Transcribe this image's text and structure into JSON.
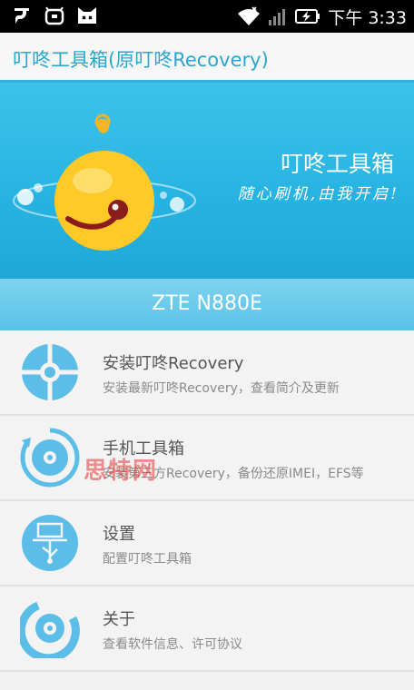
{
  "status_bar": {
    "time": "下午 3:33",
    "icons": [
      "notification-icon",
      "alarm-icon",
      "cat-app-icon",
      "wifi-icon",
      "signal-icon",
      "battery-charging-icon"
    ]
  },
  "app": {
    "title": "叮咚工具箱(原叮咚Recovery)"
  },
  "banner": {
    "title": "叮咚工具箱",
    "slogan": "随心刷机,由我开启!",
    "device": "ZTE N880E"
  },
  "menu": [
    {
      "title": "安装叮咚Recovery",
      "subtitle": "安装最新叮咚Recovery，查看简介及更新",
      "icon": "install-icon"
    },
    {
      "title": "手机工具箱",
      "subtitle": "安装第三方Recovery，备份还原IMEI，EFS等",
      "icon": "phone-toolbox-icon"
    },
    {
      "title": "设置",
      "subtitle": "配置叮咚工具箱",
      "icon": "usb-settings-icon"
    },
    {
      "title": "关于",
      "subtitle": "查看软件信息、许可协议",
      "icon": "about-icon"
    }
  ],
  "watermark": "思特网",
  "colors": {
    "accent": "#2aa6cf",
    "banner": "#28b4e2",
    "icon_blue": "#5bbde8"
  }
}
